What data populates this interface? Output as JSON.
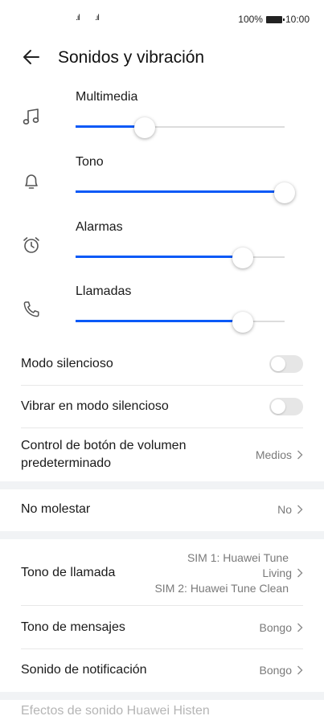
{
  "status_bar": {
    "signal_1": ".ıl",
    "signal_2": ".ıl",
    "battery": "100%",
    "time": "10:00"
  },
  "header": {
    "title": "Sonidos y vibración"
  },
  "volumes": [
    {
      "label": "Multimedia",
      "icon": "music-note-icon",
      "level": 0.33
    },
    {
      "label": "Tono",
      "icon": "bell-icon",
      "level": 1.0
    },
    {
      "label": "Alarmas",
      "icon": "alarm-clock-icon",
      "level": 0.8
    },
    {
      "label": "Llamadas",
      "icon": "phone-icon",
      "level": 0.8
    }
  ],
  "toggles": [
    {
      "label": "Modo silencioso",
      "on": false
    },
    {
      "label": "Vibrar en modo silencioso",
      "on": false
    }
  ],
  "volume_button": {
    "label": "Control de botón de volumen predeterminado",
    "value": "Medios"
  },
  "do_not_disturb": {
    "label": "No molestar",
    "value": "No"
  },
  "ringtone": {
    "label": "Tono de llamada",
    "value_line1": "SIM 1: Huawei Tune",
    "value_line2": "Living",
    "value_line3": "SIM 2: Huawei Tune Clean"
  },
  "message_tone": {
    "label": "Tono de mensajes",
    "value": "Bongo"
  },
  "notification_sound": {
    "label": "Sonido de notificación",
    "value": "Bongo"
  },
  "footer_item": {
    "label": "Efectos de sonido Huawei Histen"
  },
  "colors": {
    "accent": "#0a59f7",
    "band": "#f1f3f5"
  }
}
